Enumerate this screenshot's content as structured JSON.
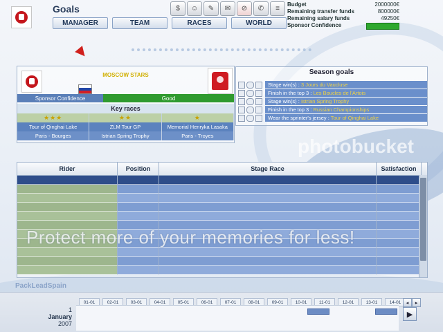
{
  "header": {
    "title": "Goals",
    "tabs": [
      {
        "label": "MANAGER"
      },
      {
        "label": "TEAM"
      },
      {
        "label": "RACES"
      },
      {
        "label": "WORLD"
      }
    ],
    "toolbar": [
      {
        "icon": "calendar-icon"
      },
      {
        "icon": "riders-icon"
      },
      {
        "icon": "money-icon"
      },
      {
        "icon": "transfer-icon"
      },
      {
        "icon": "goals-icon"
      },
      {
        "icon": "inbox-icon"
      },
      {
        "icon": "notes-icon"
      }
    ],
    "logo_text": "МОСКВА"
  },
  "finance": {
    "budget_label": "Budget",
    "budget_value": "2000000€",
    "transfer_label": "Remaining transfer funds",
    "transfer_value": "800000€",
    "salary_label": "Remaining salary funds",
    "salary_value": "49250€",
    "confidence_label": "Sponsor Confidence",
    "confidence_color": "#2ea82e"
  },
  "team": {
    "name": "MOSCOW STARS",
    "sponsor_confidence_label": "Sponsor Confidence",
    "sponsor_confidence_value": "Good",
    "key_races_title": "Key races",
    "key_races": [
      {
        "stars": "★★★",
        "race1": "Tour of Qinghai Lake",
        "race2": "Paris - Bourges"
      },
      {
        "stars": "★★",
        "race1": "ZLM Tour GP",
        "race2": "Istrian Spring Trophy"
      },
      {
        "stars": "★",
        "race1": "Memorial Henryka Lasaka",
        "race2": "Paris - Troyes"
      }
    ]
  },
  "season_goals": {
    "title": "Season goals",
    "goals": [
      {
        "prefix": "Stage win(s) : ",
        "detail": "3 Jours du Vaucluse"
      },
      {
        "prefix": "Finish in the top 3 : ",
        "detail": "Les Boucles de l'Artois"
      },
      {
        "prefix": "Stage win(s) : ",
        "detail": "Istrian Spring Trophy"
      },
      {
        "prefix": "Finish in the top 3 : ",
        "detail": "Russian Championships"
      },
      {
        "prefix": "Wear the sprinter's jersey : ",
        "detail": "Tour of Qinghai Lake"
      }
    ]
  },
  "riders_table": {
    "columns": [
      "Rider",
      "Position",
      "Stage Race",
      "Satisfaction"
    ],
    "rows": 10
  },
  "watermark": {
    "text": "Protect more of your memories for less!",
    "logo": "photobucket"
  },
  "footer": {
    "sponsor_text": "PackLeadSpain",
    "date_day": "1",
    "date_month": "January",
    "date_year": "2007",
    "months": [
      "01-01",
      "02-01",
      "03-01",
      "04-01",
      "05-01",
      "06-01",
      "07-01",
      "08-01",
      "09-01",
      "10-01",
      "11-01",
      "12-01",
      "13-01",
      "14-01"
    ],
    "prev_label": "◂",
    "next_label": "▸",
    "play_label": "▶"
  }
}
